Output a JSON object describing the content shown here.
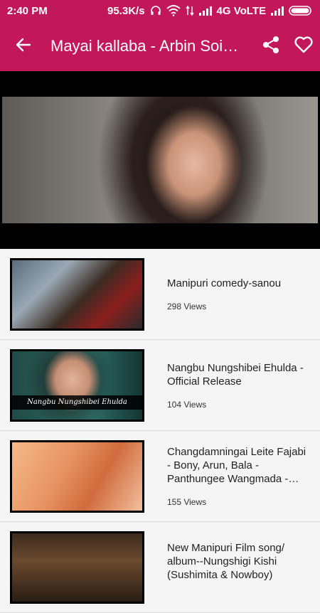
{
  "status_bar": {
    "time": "2:40 PM",
    "net_speed": "95.3K/s",
    "network": "4G VoLTE"
  },
  "app_bar": {
    "title": "Mayai kallaba - Arbin Soibam",
    "back_icon": "arrow-left-icon",
    "share_icon": "share-icon",
    "favorite_icon": "heart-outline-icon"
  },
  "videos": [
    {
      "title": "Manipuri comedy-sanou",
      "views": "298 Views"
    },
    {
      "title": "Nangbu Nungshibei Ehulda - Official Release",
      "views": "104 Views",
      "thumb_caption": "Nangbu Nungshibei Ehulda"
    },
    {
      "title": "Changdamningai Leite Fajabi - Bony, Arun, Bala - Panthungee Wangmada - Movie Song",
      "views": "155 Views"
    },
    {
      "title": "New Manipuri Film song/ album--Nungshigi Kishi (Sushimita & Nowboy)",
      "views": ""
    }
  ],
  "colors": {
    "primary": "#c2185b"
  }
}
